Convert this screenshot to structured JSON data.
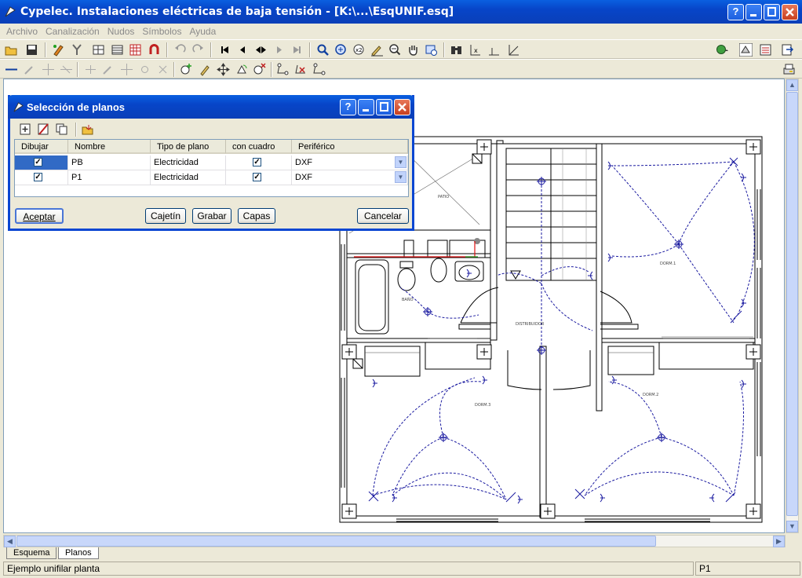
{
  "window": {
    "title": "Cypelec. Instalaciones eléctricas de baja tensión - [K:\\...\\EsqUNIF.esq]",
    "help_label": "?"
  },
  "menu": [
    "Archivo",
    "Canalización",
    "Nudos",
    "Símbolos",
    "Ayuda"
  ],
  "dialog": {
    "title": "Selección de planos",
    "help_label": "?",
    "columns": [
      "Dibujar",
      "Nombre",
      "Tipo de plano",
      "con cuadro",
      "Periférico"
    ],
    "rows": [
      {
        "dibujar": true,
        "nombre": "PB",
        "tipo": "Electricidad",
        "con_cuadro": true,
        "periferico": "DXF",
        "selected": true
      },
      {
        "dibujar": true,
        "nombre": "P1",
        "tipo": "Electricidad",
        "con_cuadro": true,
        "periferico": "DXF",
        "selected": false
      }
    ],
    "buttons": {
      "accept": "Aceptar",
      "cajetin": "Cajetín",
      "grabar": "Grabar",
      "capas": "Capas",
      "cancel": "Cancelar"
    }
  },
  "plan": {
    "room_labels": {
      "patio": "PATIO",
      "bano": "BAÑO",
      "distribuidor": "DISTRIBUIDOR",
      "dorm1": "DORM.1",
      "dorm2": "DORM.2",
      "dorm3": "DORM.3"
    },
    "wall_color": "#000000",
    "circuit_color": "#1a1aa0",
    "red_line_color": "#e01010"
  },
  "tabs": [
    {
      "label": "Esquema",
      "active": false
    },
    {
      "label": "Planos",
      "active": true
    }
  ],
  "status": {
    "message": "Ejemplo unifilar planta",
    "plan": "P1"
  }
}
